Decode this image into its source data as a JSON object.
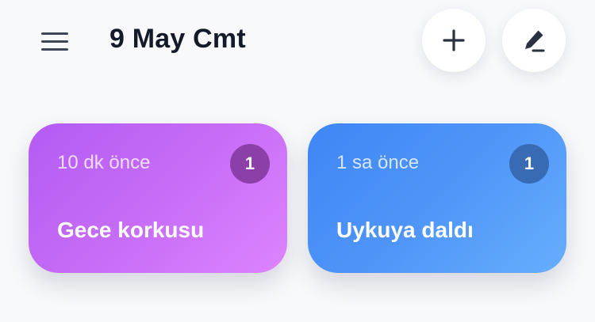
{
  "header": {
    "title": "9 May Cmt",
    "menu_icon": "hamburger-menu-icon",
    "add_icon": "plus-icon",
    "edit_icon": "pencil-icon"
  },
  "cards": [
    {
      "time": "10 dk önce",
      "count": "1",
      "label": "Gece korkusu",
      "color": "#c76cf6"
    },
    {
      "time": "1 sa önce",
      "count": "1",
      "label": "Uykuya daldı",
      "color": "#4f95f8"
    }
  ]
}
